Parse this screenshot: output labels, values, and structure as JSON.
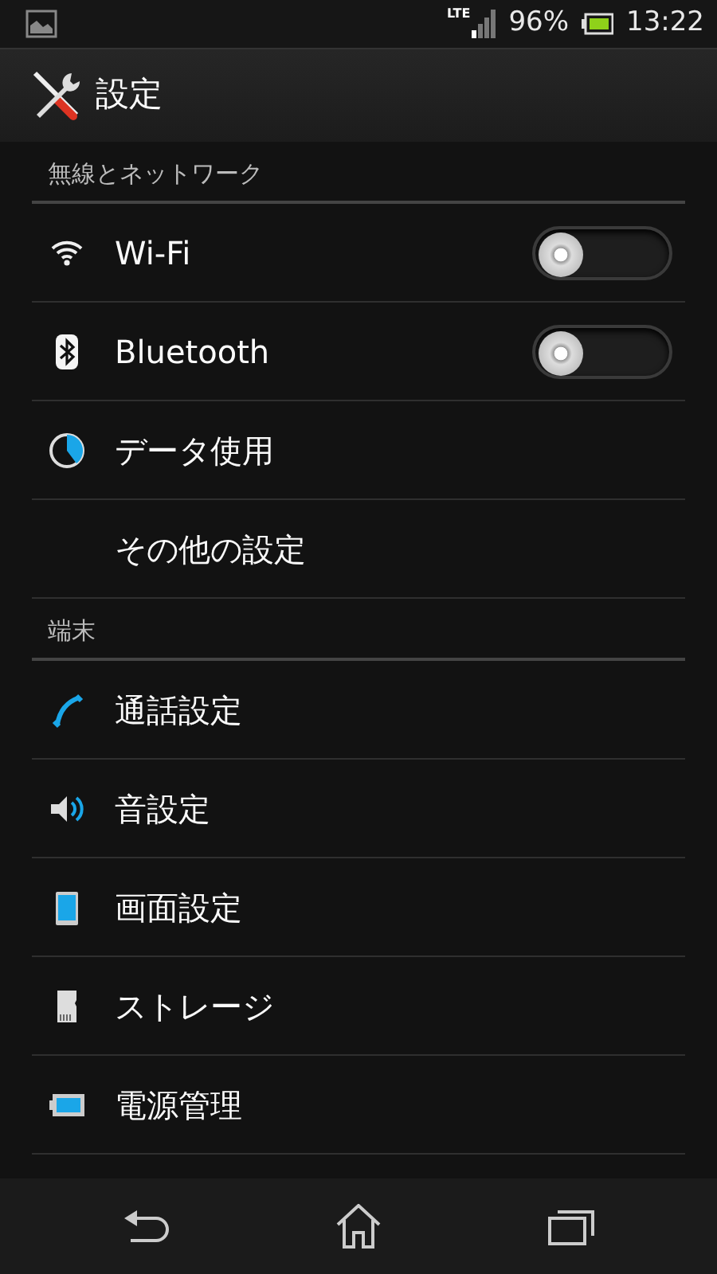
{
  "status_bar": {
    "network": "LTE",
    "battery": "96%",
    "time": "13:22"
  },
  "action_bar": {
    "title": "設定"
  },
  "sections": [
    {
      "header": "無線とネットワーク",
      "items": [
        {
          "label": "Wi-Fi",
          "kind": "toggle",
          "on": false
        },
        {
          "label": "Bluetooth",
          "kind": "toggle",
          "on": false
        },
        {
          "label": "データ使用",
          "kind": "plain"
        },
        {
          "label": "その他の設定",
          "kind": "plain"
        }
      ]
    },
    {
      "header": "端末",
      "items": [
        {
          "label": "通話設定",
          "kind": "plain"
        },
        {
          "label": "音設定",
          "kind": "plain"
        },
        {
          "label": "画面設定",
          "kind": "plain"
        },
        {
          "label": "ストレージ",
          "kind": "plain"
        },
        {
          "label": "電源管理",
          "kind": "plain"
        }
      ]
    }
  ]
}
